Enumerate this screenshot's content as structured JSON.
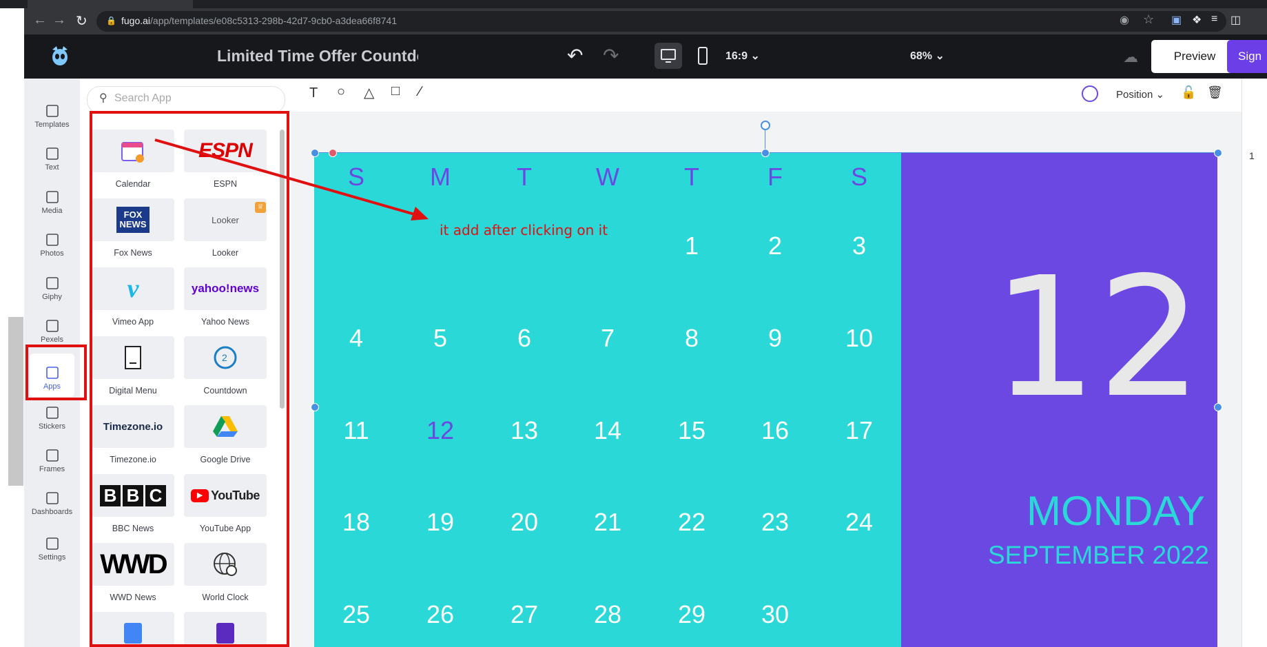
{
  "browser": {
    "url_host": "fugo.ai",
    "url_path": "/app/templates/e08c5313-298b-42d7-9cb0-a3dea66f8741"
  },
  "header": {
    "doc_title": "Limited Time Offer Countdown",
    "aspect_ratio": "16:9",
    "zoom": "68%",
    "preview_label": "Preview",
    "signin_label": "Sign I"
  },
  "rail": {
    "items": [
      {
        "label": "Templates",
        "icon": "templates-icon"
      },
      {
        "label": "Text",
        "icon": "text-icon"
      },
      {
        "label": "Media",
        "icon": "media-icon"
      },
      {
        "label": "Photos",
        "icon": "photos-icon"
      },
      {
        "label": "Giphy",
        "icon": "gif-icon"
      },
      {
        "label": "Pexels",
        "icon": "pexels-icon"
      },
      {
        "label": "Apps",
        "icon": "apps-icon"
      },
      {
        "label": "Stickers",
        "icon": "stickers-icon"
      },
      {
        "label": "Frames",
        "icon": "frames-icon"
      },
      {
        "label": "Dashboards",
        "icon": "dashboards-icon"
      },
      {
        "label": "Settings",
        "icon": "settings-icon"
      }
    ]
  },
  "apps_panel": {
    "search_placeholder": "Search App",
    "apps": [
      {
        "label": "Calendar"
      },
      {
        "label": "ESPN"
      },
      {
        "label": "Fox News"
      },
      {
        "label": "Looker"
      },
      {
        "label": "Vimeo App"
      },
      {
        "label": "Yahoo News"
      },
      {
        "label": "Digital Menu"
      },
      {
        "label": "Countdown"
      },
      {
        "label": "Timezone.io"
      },
      {
        "label": "Google Drive"
      },
      {
        "label": "BBC News"
      },
      {
        "label": "YouTube App"
      },
      {
        "label": "WWD News"
      },
      {
        "label": "World Clock"
      }
    ],
    "logo_text": {
      "espn": "ESPN",
      "fox": "FOX NEWS",
      "looker": "Looker",
      "yahoo": "yahoo!news",
      "timezone": "Timezone.io",
      "bbc": [
        "B",
        "B",
        "C"
      ],
      "youtube": "YouTube",
      "wwd": "WWD"
    }
  },
  "toolbar": {
    "position_label": "Position"
  },
  "calendar": {
    "weekdays": [
      "S",
      "M",
      "T",
      "W",
      "T",
      "F",
      "S"
    ],
    "weeks": [
      [
        "",
        "",
        "",
        "",
        "1",
        "2",
        "3"
      ],
      [
        "4",
        "5",
        "6",
        "7",
        "8",
        "9",
        "10"
      ],
      [
        "11",
        "12",
        "13",
        "14",
        "15",
        "16",
        "17"
      ],
      [
        "18",
        "19",
        "20",
        "21",
        "22",
        "23",
        "24"
      ],
      [
        "25",
        "26",
        "27",
        "28",
        "29",
        "30",
        ""
      ]
    ],
    "highlight_day": "12",
    "big_day": "12",
    "day_name": "MONDAY",
    "month_year": "SEPTEMBER 2022",
    "colors": {
      "left": "#2ad8d8",
      "right": "#6c48e3"
    }
  },
  "annotation": {
    "text": "it add after clicking on it",
    "color": "#e01010"
  },
  "pages": {
    "current": "1"
  }
}
